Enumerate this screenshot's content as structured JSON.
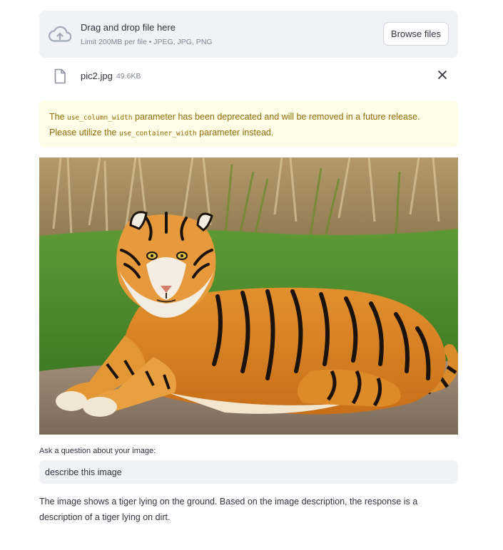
{
  "uploader": {
    "title": "Drag and drop file here",
    "subtitle": "Limit 200MB per file • JPEG, JPG, PNG",
    "browse_label": "Browse files",
    "icon": "cloud-upload-icon"
  },
  "file": {
    "name": "pic2.jpg",
    "size": "49.6KB",
    "icon": "file-icon",
    "remove_icon": "close-icon"
  },
  "warning": {
    "part1": "The ",
    "code1": "use_column_width",
    "part2": " parameter has been deprecated and will be removed in a future release. Please utilize the ",
    "code2": "use_container_width",
    "part3": " parameter instead.",
    "color": "#926c05",
    "background": "#fffce7"
  },
  "image": {
    "subject": "tiger-photo"
  },
  "question": {
    "label": "Ask a question about your image:",
    "value": "describe this image"
  },
  "answer": {
    "text": "The image shows a tiger lying on the ground. Based on the image description, the response is a description of a tiger lying on dirt."
  }
}
